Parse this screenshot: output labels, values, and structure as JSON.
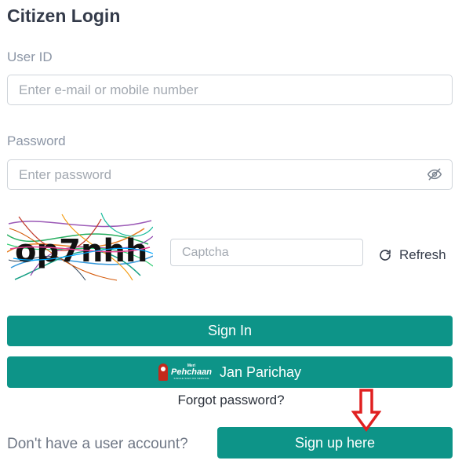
{
  "form": {
    "title": "Citizen Login",
    "user_id_label": "User ID",
    "user_id_placeholder": "Enter e-mail or mobile number",
    "password_label": "Password",
    "password_placeholder": "Enter password",
    "captcha_text": "op7nhh",
    "captcha_placeholder": "Captcha",
    "refresh_label": "Refresh",
    "sign_in_label": "Sign In",
    "jan_parichay_label": "Jan Parichay",
    "jan_parichay_logo": {
      "top_text": "Meri",
      "main_text": "Pehchaan",
      "tagline": "SINGLE SIGN ON SERVICE"
    },
    "forgot_password_label": "Forgot password?",
    "no_account_text": "Don't have a user account?",
    "sign_up_label": "Sign up here"
  },
  "colors": {
    "primary": "#0d9488",
    "annotation_arrow": "#e02020"
  },
  "icons": {
    "password_toggle": "eye-slash-icon",
    "refresh": "refresh-icon",
    "annotation": "down-arrow-icon"
  }
}
